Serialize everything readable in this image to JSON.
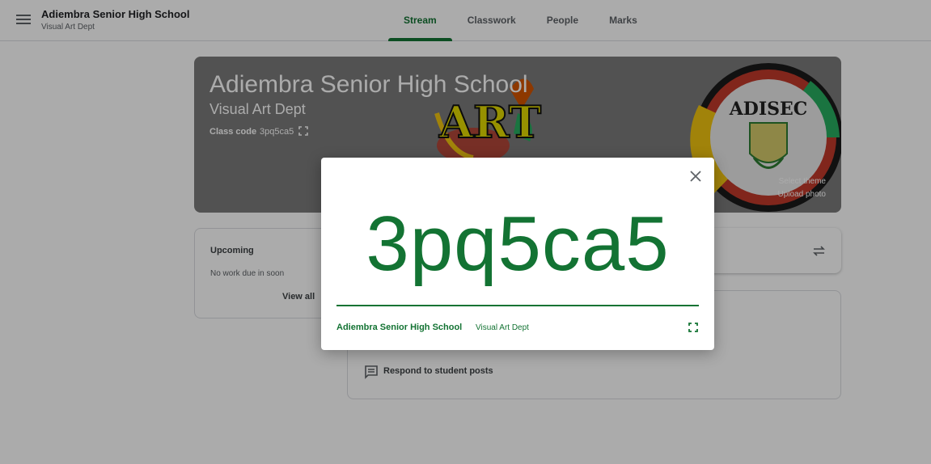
{
  "app": {
    "title": "Adiembra Senior High School",
    "subtitle": "Visual Art Dept"
  },
  "tabs": [
    {
      "label": "Stream",
      "active": true
    },
    {
      "label": "Classwork",
      "active": false
    },
    {
      "label": "People",
      "active": false
    },
    {
      "label": "Marks",
      "active": false
    }
  ],
  "banner": {
    "title": "Adiembra Senior High School",
    "subtitle": "Visual Art Dept",
    "class_code_label": "Class code",
    "class_code_value": "3pq5ca5",
    "art_logo_text": "ART",
    "seal_text": "ADISEC",
    "select_theme": "Select theme",
    "upload_photo": "Upload photo"
  },
  "upcoming": {
    "title": "Upcoming",
    "text": "No work due in soon",
    "view_all": "View all"
  },
  "stream": {
    "tip_text": "Respond to student posts"
  },
  "modal": {
    "code": "3pq5ca5",
    "class_name": "Adiembra Senior High School",
    "section": "Visual Art Dept"
  },
  "colors": {
    "accent": "#137333",
    "banner_bg": "#7b7b7b"
  }
}
